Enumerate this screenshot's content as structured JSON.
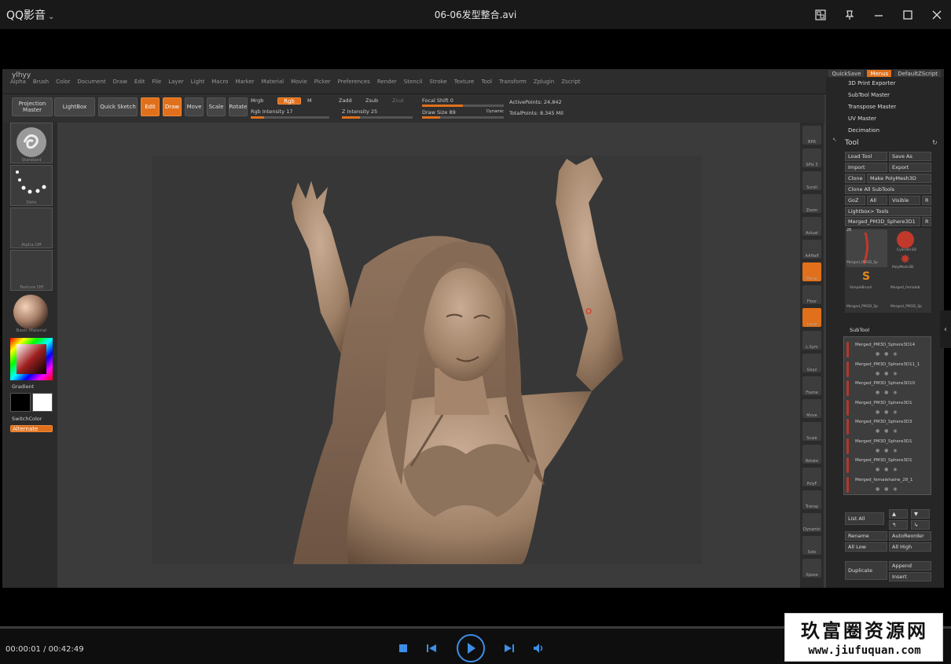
{
  "player": {
    "app_name": "QQ影音",
    "file_title": "06-06发型整合.avi",
    "time_display": "00:00:01 / 00:42:49",
    "accent": "#3d8ee8"
  },
  "watermark": {
    "cn": "玖富圈资源网",
    "url": "www.jiufuquan.com"
  },
  "zbrush": {
    "logo": "ylhyy",
    "menu": [
      "Alpha",
      "Brush",
      "Color",
      "Document",
      "Draw",
      "Edit",
      "File",
      "Layer",
      "Light",
      "Macro",
      "Marker",
      "Material",
      "Movie",
      "Picker",
      "Preferences",
      "Render",
      "Stencil",
      "Stroke",
      "Texture",
      "Tool",
      "Transform",
      "Zplugin",
      "Zscript"
    ],
    "topright": {
      "quicksave": "QuickSave",
      "menus": "Menus",
      "defaultscript": "DefaultZScript"
    },
    "toolbar": {
      "projection_master": "Projection Master",
      "lightbox": "LightBox",
      "quick_sketch": "Quick Sketch",
      "edit": "Edit",
      "draw": "Draw",
      "move": "Move",
      "scale": "Scale",
      "rotate": "Rotate",
      "mrgb": "Mrgb",
      "rgb": "Rgb",
      "m": "M",
      "rgb_intensity": "Rgb Intensity 17",
      "zadd": "Zadd",
      "zsub": "Zsub",
      "zcut": "Zcut",
      "z_intensity": "Z Intensity 25",
      "focal_shift": "Focal Shift 0",
      "draw_size": "Draw Size 89",
      "dynamic": "Dynamic",
      "active_points": "ActivePoints: 24,842",
      "total_points": "TotalPoints: 8.345 Mil"
    },
    "left_shelf": [
      "Standard",
      "Dots",
      "Alpha Off",
      "Texture Off",
      "Basic Material",
      "Gradient",
      "SwitchColor",
      "Alternate"
    ],
    "right_shelf": [
      "BPR",
      "SPix 3",
      "Scroll",
      "Zoom",
      "Actual",
      "AAHalf",
      "Persp",
      "Floor",
      "Local",
      "L.Sym",
      "Gxyz",
      "Frame",
      "Move",
      "Scale",
      "Rotate",
      "PolyF",
      "Transp",
      "Dynamic",
      "Solo",
      "Xpose"
    ],
    "tool_panel": {
      "plugins": [
        "3D Print Exporter",
        "SubTool Master",
        "Transpose Master",
        "UV Master",
        "Decimation"
      ],
      "title": "Tool",
      "buttons": [
        "Load Tool",
        "Save As",
        "Import",
        "Export",
        "Clone",
        "Make PolyMesh3D",
        "Clone All SubTools",
        "GoZ",
        "All",
        "Visible",
        "R",
        "Lightbox> Tools",
        "Merged_PM3D_Sphere3D1",
        "R"
      ],
      "thumbs": [
        "Merged_PM3D_Sp",
        "Cylinder3D",
        "PolyMesh3D",
        "SimpleBrush",
        "Merged_femaleb",
        "Merged_PM3D_Sp",
        "Merged_PM3D_Sp"
      ],
      "thumb_count": "26",
      "subtool_title": "SubTool",
      "subtools": [
        "Merged_PM3D_Sphere3D14",
        "Merged_PM3D_Sphere3D11_1",
        "Merged_PM3D_Sphere3D10",
        "Merged_PM3D_Sphere3D1",
        "Merged_PM3D_Sphere3D3",
        "Merged_PM3D_Sphere3D1",
        "Merged_PM3D_Sphere3D1",
        "Merged_femalehairw_28_1"
      ],
      "list_buttons": [
        "List All",
        "Rename",
        "AutoReorder",
        "All Low",
        "All High",
        "Duplicate",
        "Append",
        "Insert"
      ]
    }
  }
}
